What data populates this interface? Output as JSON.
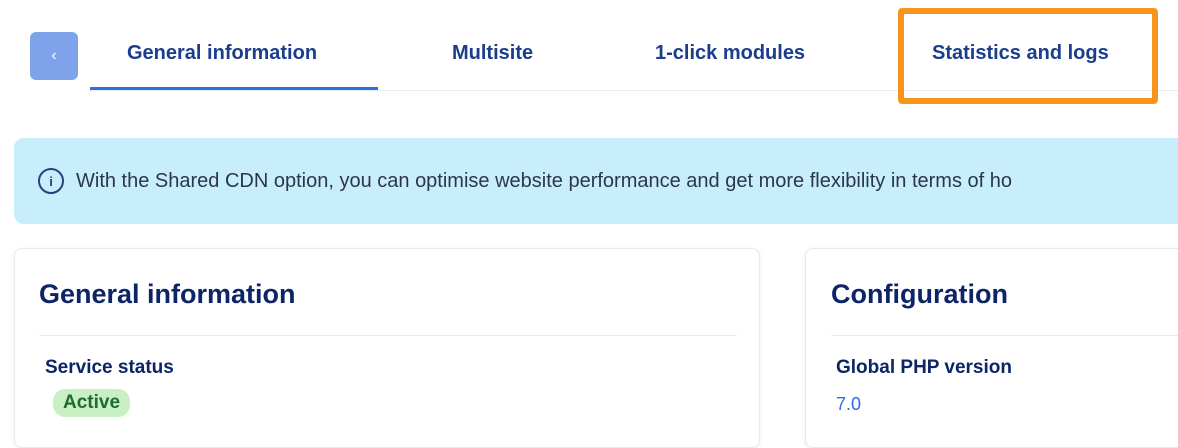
{
  "tabs": {
    "back_icon": "chevron-left-icon",
    "items": [
      {
        "label": "General information",
        "active": true
      },
      {
        "label": "Multisite",
        "active": false
      },
      {
        "label": "1-click modules",
        "active": false
      },
      {
        "label": "Statistics and logs",
        "active": false,
        "highlighted": true
      }
    ]
  },
  "banner": {
    "icon": "info-circle-icon",
    "text": "With the Shared CDN option, you can optimise website performance and get more flexibility in terms of ho"
  },
  "general_card": {
    "title": "General information",
    "service_status_label": "Service status",
    "service_status_value": "Active"
  },
  "config_card": {
    "title": "Configuration",
    "php_label": "Global PHP version",
    "php_value": "7.0"
  },
  "colors": {
    "accent": "#2f6de2",
    "highlight": "#f7941d",
    "banner_bg": "#c7eefa",
    "badge_bg": "#c9f0c5",
    "heading": "#0d2466"
  }
}
